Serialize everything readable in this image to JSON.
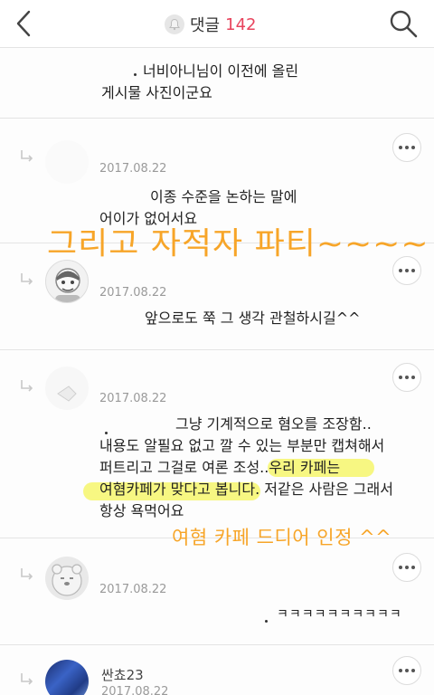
{
  "header": {
    "title": "댓글",
    "count": "142"
  },
  "comments": [
    {
      "line1": "너비아니님이 이전에 올린",
      "line2": "게시물 사진이군요"
    },
    {
      "date": "2017.08.22",
      "line1": "이종 수준을 논하는 말에",
      "line2": "어이가 없어서요"
    },
    {
      "date": "2017.08.22",
      "line1": "앞으로도 쭉 그 생각 관철하시길^^"
    },
    {
      "date": "2017.08.22",
      "line1": "그냥 기계적으로 혐오를 조장함..",
      "line2": "내용도 알필요 없고 깔 수 있는 부분만 캡쳐해서",
      "line3": "퍼트리고 그걸로 여론 조성..우리 카페는",
      "line4": "여혐카페가 맞다고 봅니다. 저같은 사람은 그래서",
      "line5": "항상 욕먹어요"
    },
    {
      "date": "2017.08.22",
      "line1": "ㅋㅋㅋㅋㅋㅋㅋㅋㅋㅋ"
    },
    {
      "name": "싼쵸23",
      "date": "2017.08.22"
    }
  ],
  "annotations": {
    "big": "그리고 자적자 파티~~~~",
    "small": "여혐 카페 드디어 인정 ^^",
    "color": "#f7a528"
  },
  "colors": {
    "accent": "#e8435c",
    "highlight": "#f4f458"
  }
}
